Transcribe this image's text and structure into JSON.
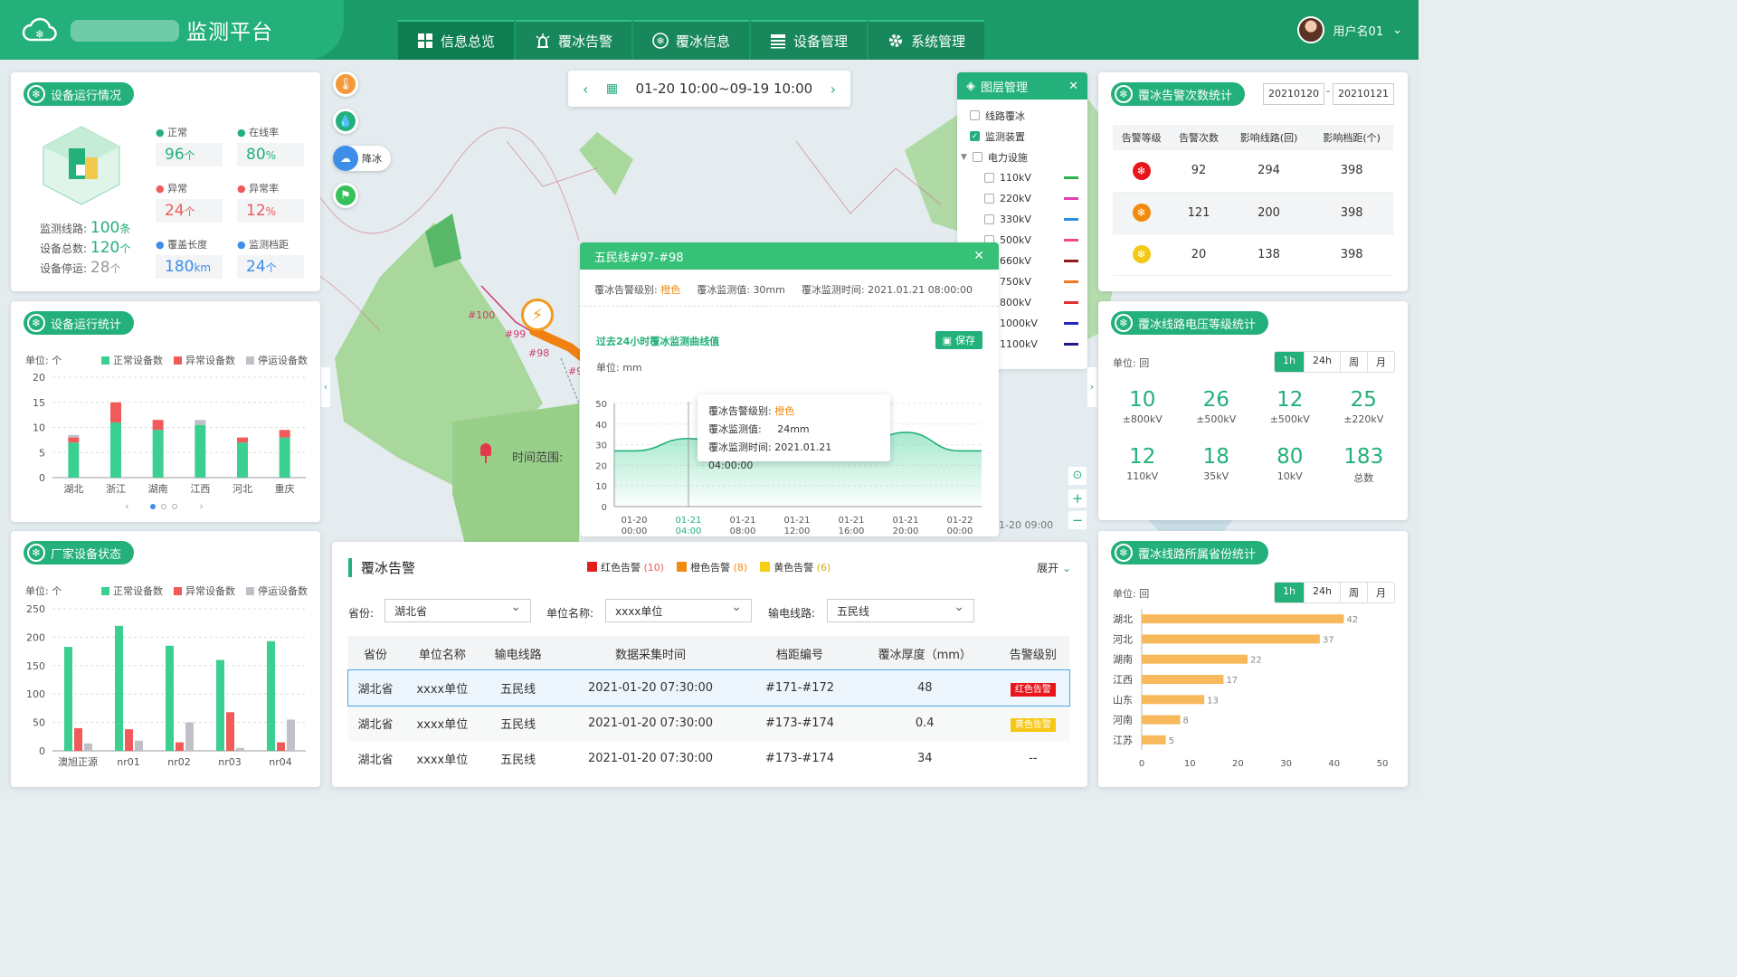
{
  "header": {
    "title": "监测平台",
    "nav": [
      "信息总览",
      "覆冰告警",
      "覆冰信息",
      "设备管理",
      "系统管理"
    ],
    "user": "用户名01"
  },
  "device_status": {
    "title": "设备运行情况",
    "normal_label": "正常",
    "normal": "96",
    "online_label": "在线率",
    "online": "80",
    "abnormal_label": "异常",
    "abnormal": "24",
    "abnormal_rate_label": "异常率",
    "abnormal_rate": "12",
    "cover_label": "覆盖长度",
    "cover": "180",
    "spans_label": "监测档距",
    "spans": "24",
    "lines_label": "监测线路:",
    "lines": "100",
    "total_label": "设备总数:",
    "total": "120",
    "stopped_label": "设备停运:",
    "stopped": "28",
    "unit_ge": "个",
    "unit_pct": "%",
    "unit_km": "km",
    "unit_tiao": "条"
  },
  "device_stats": {
    "title": "设备运行统计",
    "unit": "单位: 个",
    "legend": [
      "正常设备数",
      "异常设备数",
      "停运设备数"
    ]
  },
  "vendor_status": {
    "title": "厂家设备状态",
    "unit": "单位: 个",
    "legend": [
      "正常设备数",
      "异常设备数",
      "停运设备数"
    ]
  },
  "chart_data": [
    {
      "type": "bar",
      "title": "设备运行统计",
      "categories": [
        "湖北",
        "浙江",
        "湖南",
        "江西",
        "河北",
        "重庆"
      ],
      "ylim": [
        0,
        20
      ],
      "yticks": [
        0,
        5,
        10,
        15,
        20
      ],
      "series": [
        {
          "name": "正常设备数",
          "values": [
            7,
            11,
            9.5,
            10.5,
            7,
            8
          ]
        },
        {
          "name": "异常设备数",
          "values": [
            1,
            4,
            2,
            0,
            1,
            1.5
          ]
        },
        {
          "name": "停运设备数",
          "values": [
            0.5,
            0,
            0,
            1,
            0,
            0
          ]
        }
      ],
      "stacked": true
    },
    {
      "type": "bar",
      "title": "厂家设备状态",
      "categories": [
        "澳旭正源",
        "nr01",
        "nr02",
        "nr03",
        "nr04"
      ],
      "ylim": [
        0,
        250
      ],
      "yticks": [
        0,
        50,
        100,
        150,
        200,
        250
      ],
      "series": [
        {
          "name": "正常设备数",
          "values": [
            183,
            220,
            185,
            160,
            193
          ]
        },
        {
          "name": "异常设备数",
          "values": [
            40,
            38,
            15,
            68,
            15
          ]
        },
        {
          "name": "停运设备数",
          "values": [
            13,
            18,
            50,
            5,
            55
          ]
        }
      ]
    },
    {
      "type": "area",
      "title": "过去24小时覆冰监测曲线值",
      "ylabel": "单位: mm",
      "ylim": [
        0,
        50
      ],
      "yticks": [
        0,
        10,
        20,
        30,
        40,
        50
      ],
      "x": [
        "01-20 00:00",
        "01-21 04:00",
        "01-21 08:00",
        "01-21 12:00",
        "01-21 16:00",
        "01-21 20:00",
        "01-22 00:00"
      ],
      "values": [
        27,
        33,
        25,
        25,
        27,
        36,
        27
      ]
    },
    {
      "type": "bar",
      "title": "覆冰线路所属省份统计",
      "orientation": "horizontal",
      "categories": [
        "湖北",
        "河北",
        "湖南",
        "江西",
        "山东",
        "河南",
        "江苏"
      ],
      "values": [
        42,
        37,
        22,
        17,
        13,
        8,
        5
      ],
      "xlim": [
        0,
        50
      ],
      "xticks": [
        0,
        10,
        20,
        30,
        40,
        50
      ]
    }
  ],
  "map": {
    "date_range": "01-20 10:00~09-19 10:00",
    "rain_label": "降冰",
    "time_label": "时间范围:",
    "time_tail": "1-20 09:00",
    "tower_labels": [
      "#100",
      "#99",
      "#98",
      "#9"
    ],
    "layers": {
      "title": "图层管理",
      "items": [
        "线路覆冰",
        "监测装置",
        "电力设施"
      ],
      "voltages": [
        "110kV",
        "220kV",
        "330kV",
        "500kV",
        "660kV",
        "750kV",
        "800kV",
        "1000kV",
        "1100kV"
      ],
      "colors": [
        "#2db34a",
        "#e23fb0",
        "#2f8de4",
        "#f04a7a",
        "#8b1e1e",
        "#f07a20",
        "#e23030",
        "#2424c8",
        "#1a1a8a"
      ]
    }
  },
  "popup": {
    "title": "五民线#97-#98",
    "level_label": "覆冰告警级别:",
    "level": "橙色",
    "value_label": "覆冰监测值:",
    "value": "30mm",
    "time_label": "覆冰监测时间:",
    "time": "2021.01.21 08:00:00",
    "chart_title": "过去24小时覆冰监测曲线值",
    "save": "保存",
    "unit": "单位: mm",
    "tooltip": {
      "level_label": "覆冰告警级别:",
      "level": "橙色",
      "value_label": "覆冰监测值:",
      "value": "24mm",
      "time_label": "覆冰监测时间:",
      "time": "2021.01.21 04:00:00"
    }
  },
  "alarm": {
    "title": "覆冰告警",
    "red": "红色告警",
    "red_n": "(10)",
    "orange": "橙色告警",
    "orange_n": "(8)",
    "yellow": "黄色告警",
    "yellow_n": "(6)",
    "expand": "展开",
    "province_label": "省份:",
    "province": "湖北省",
    "unit_label": "单位名称:",
    "unit": "xxxx单位",
    "line_label": "输电线路:",
    "line": "五民线",
    "columns": [
      "省份",
      "单位名称",
      "输电线路",
      "数据采集时间",
      "档距编号",
      "覆冰厚度（mm）",
      "告警级别"
    ],
    "rows": [
      [
        "湖北省",
        "xxxx单位",
        "五民线",
        "2021-01-20 07:30:00",
        "#171-#172",
        "48",
        "红色告警"
      ],
      [
        "湖北省",
        "xxxx单位",
        "五民线",
        "2021-01-20 07:30:00",
        "#173-#174",
        "0.4",
        "黄色告警"
      ],
      [
        "湖北省",
        "xxxx单位",
        "五民线",
        "2021-01-20 07:30:00",
        "#173-#174",
        "34",
        "--"
      ]
    ]
  },
  "warn_count": {
    "title": "覆冰告警次数统计",
    "date_from": "20210120",
    "date_to": "20210121",
    "columns": [
      "告警等级",
      "告警次数",
      "影响线路(回)",
      "影响档距(个)"
    ],
    "rows": [
      [
        "92",
        "294",
        "398"
      ],
      [
        "121",
        "200",
        "398"
      ],
      [
        "20",
        "138",
        "398"
      ]
    ]
  },
  "voltage": {
    "title": "覆冰线路电压等级统计",
    "unit": "单位: 回",
    "tabs": [
      "1h",
      "24h",
      "周",
      "月"
    ],
    "items": [
      [
        "10",
        "±800kV"
      ],
      [
        "26",
        "±500kV"
      ],
      [
        "12",
        "±500kV"
      ],
      [
        "25",
        "±220kV"
      ],
      [
        "12",
        "110kV"
      ],
      [
        "18",
        "35kV"
      ],
      [
        "80",
        "10kV"
      ],
      [
        "183",
        "总数"
      ]
    ]
  },
  "province": {
    "title": "覆冰线路所属省份统计",
    "unit": "单位: 回",
    "tabs": [
      "1h",
      "24h",
      "周",
      "月"
    ]
  }
}
